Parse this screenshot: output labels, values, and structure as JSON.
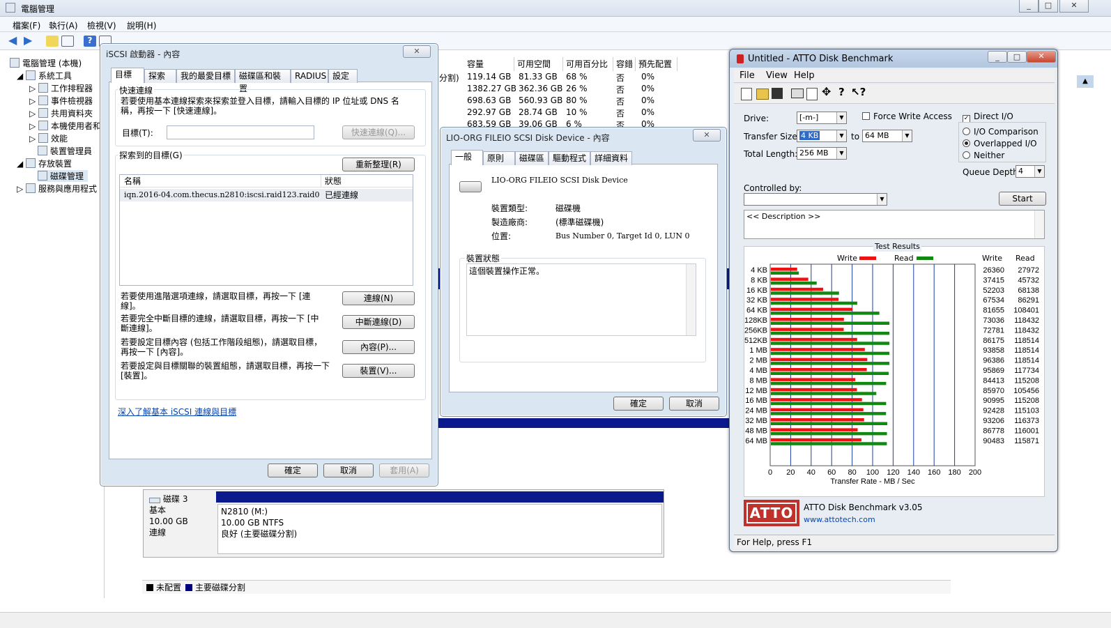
{
  "cm": {
    "title": "電腦管理",
    "menu": [
      "檔案(F)",
      "執行(A)",
      "檢視(V)",
      "說明(H)"
    ],
    "tree": [
      {
        "label": "電腦管理 (本機)",
        "level": 0
      },
      {
        "label": "系統工具",
        "level": 1
      },
      {
        "label": "工作排程器",
        "level": 2
      },
      {
        "label": "事件檢視器",
        "level": 2
      },
      {
        "label": "共用資料夾",
        "level": 2
      },
      {
        "label": "本機使用者和",
        "level": 2
      },
      {
        "label": "效能",
        "level": 2
      },
      {
        "label": "裝置管理員",
        "level": 2
      },
      {
        "label": "存放裝置",
        "level": 1
      },
      {
        "label": "磁碟管理",
        "level": 2
      },
      {
        "label": "服務與應用程式",
        "level": 1
      }
    ],
    "columns": [
      "容量",
      "可用空間",
      "可用百分比",
      "容錯",
      "預先配置"
    ],
    "rows": [
      {
        "pre": "分割)",
        "cap": "119.14 GB",
        "free": "81.33 GB",
        "pct": "68 %",
        "ft": "否",
        "oh": "0%"
      },
      {
        "pre": "",
        "cap": "1382.27 GB",
        "free": "362.36 GB",
        "pct": "26 %",
        "ft": "否",
        "oh": "0%"
      },
      {
        "pre": "",
        "cap": "698.63 GB",
        "free": "560.93 GB",
        "pct": "80 %",
        "ft": "否",
        "oh": "0%"
      },
      {
        "pre": "",
        "cap": "292.97 GB",
        "free": "28.74 GB",
        "pct": "10 %",
        "ft": "否",
        "oh": "0%"
      },
      {
        "pre": "",
        "cap": "683.59 GB",
        "free": "39.06 GB",
        "pct": "6 %",
        "ft": "否",
        "oh": "0%"
      }
    ],
    "disk": {
      "name": "磁碟 3",
      "type": "基本",
      "size": "10.00 GB",
      "status": "連線",
      "vol": "N2810 (M:)",
      "fs": "10.00 GB NTFS",
      "health": "良好 (主要磁碟分割)"
    },
    "legend": [
      {
        "label": "未配置",
        "color": "#000000"
      },
      {
        "label": "主要磁碟分割",
        "color": "#00007f"
      }
    ]
  },
  "iscsi": {
    "title": "iSCSI 啟動器 - 內容",
    "tabs": [
      "目標",
      "探索",
      "我的最愛目標",
      "磁碟區和裝置",
      "RADIUS",
      "設定"
    ],
    "quick_group": "快速連線",
    "quick_desc": "若要使用基本連線探索來探索並登入目標，請輸入目標的 IP 位址或 DNS 名稱，再按一下 [快速連線]。",
    "target_label": "目標(T):",
    "target_value": "",
    "quick_btn": "快速連線(Q)...",
    "discovered_group": "探索到的目標(G)",
    "refresh_btn": "重新整理(R)",
    "col_name": "名稱",
    "col_status": "狀態",
    "target_name": "iqn.2016-04.com.thecus.n2810:iscsi.raid123.raid0",
    "target_status": "已經連線",
    "d1": "若要使用進階選項連線，請選取目標，再按一下 [連線]。",
    "b1": "連線(N)",
    "d2": "若要完全中斷目標的連線，請選取目標，再按一下 [中斷連線]。",
    "b2": "中斷連線(D)",
    "d3": "若要設定目標內容 (包括工作階段組態)，請選取目標，再按一下 [內容]。",
    "b3": "內容(P)...",
    "d4": "若要設定與目標關聯的裝置組態，請選取目標，再按一下 [裝置]。",
    "b4": "裝置(V)...",
    "link": "深入了解基本 iSCSI 連線與目標",
    "ok": "確定",
    "cancel": "取消",
    "apply": "套用(A)"
  },
  "devprops": {
    "title": "LIO-ORG FILEIO SCSI Disk Device - 內容",
    "tabs": [
      "一般",
      "原則",
      "磁碟區",
      "驅動程式",
      "詳細資料"
    ],
    "name": "LIO-ORG FILEIO SCSI Disk Device",
    "type_label": "裝置類型:",
    "type_value": "磁碟機",
    "mfr_label": "製造廠商:",
    "mfr_value": "(標準磁碟機)",
    "loc_label": "位置:",
    "loc_value": "Bus Number 0, Target Id 0, LUN 0",
    "status_group": "裝置狀態",
    "status_text": "這個裝置操作正常。",
    "ok": "確定",
    "cancel": "取消"
  },
  "atto": {
    "title": "Untitled - ATTO Disk Benchmark",
    "menu": [
      "File",
      "View",
      "Help"
    ],
    "drive_label": "Drive:",
    "drive": "[-m-]",
    "force_write": "Force Write Access",
    "direct_io": "Direct I/O",
    "ts_label": "Transfer Size:",
    "ts_from": "4 KB",
    "ts_to_label": "to",
    "ts_to": "64 MB",
    "tl_label": "Total Length:",
    "tl": "256 MB",
    "io_cmp": "I/O Comparison",
    "overlapped": "Overlapped I/O",
    "neither": "Neither",
    "qd_label": "Queue Depth:",
    "qd": "4",
    "controlled_by": "Controlled by:",
    "start": "Start",
    "description": "<< Description >>",
    "results_title": "Test Results",
    "write_label": "Write",
    "read_label": "Read",
    "write_color": "#ee1111",
    "read_color": "#118811",
    "col_write": "Write",
    "col_read": "Read",
    "logo": "ATTO",
    "version": "ATTO Disk Benchmark v3.05",
    "url": "www.attotech.com",
    "status": "For Help, press F1"
  },
  "chart_data": {
    "type": "bar",
    "title": "Test Results",
    "xlabel": "Transfer Rate - MB / Sec",
    "xlim": [
      0,
      200
    ],
    "xticks": [
      0,
      20,
      40,
      60,
      80,
      100,
      120,
      140,
      160,
      180,
      200
    ],
    "categories": [
      "4 KB",
      "8 KB",
      "16 KB",
      "32 KB",
      "64 KB",
      "128KB",
      "256KB",
      "512KB",
      "1 MB",
      "2 MB",
      "4 MB",
      "8 MB",
      "12 MB",
      "16 MB",
      "24 MB",
      "32 MB",
      "48 MB",
      "64 MB"
    ],
    "series": [
      {
        "name": "Write",
        "values": [
          25.7,
          36.5,
          51.0,
          66.0,
          79.7,
          71.3,
          71.1,
          84.2,
          91.7,
          94.1,
          93.6,
          82.4,
          84.0,
          88.9,
          90.3,
          91.0,
          84.7,
          88.4
        ]
      },
      {
        "name": "Read",
        "values": [
          27.3,
          44.7,
          66.5,
          84.3,
          105.9,
          115.7,
          115.7,
          115.7,
          115.7,
          115.7,
          115.0,
          112.5,
          102.9,
          112.5,
          112.4,
          113.6,
          113.3,
          113.2
        ]
      }
    ],
    "write_kb": [
      "26360",
      "37415",
      "52203",
      "67534",
      "81655",
      "73036",
      "72781",
      "86175",
      "93858",
      "96386",
      "95869",
      "84413",
      "85970",
      "90995",
      "92428",
      "93206",
      "86778",
      "90483"
    ],
    "read_kb": [
      "27972",
      "45732",
      "68138",
      "86291",
      "108401",
      "118432",
      "118432",
      "118514",
      "118514",
      "118514",
      "117734",
      "115208",
      "105456",
      "115208",
      "115103",
      "116373",
      "116001",
      "115871"
    ]
  }
}
